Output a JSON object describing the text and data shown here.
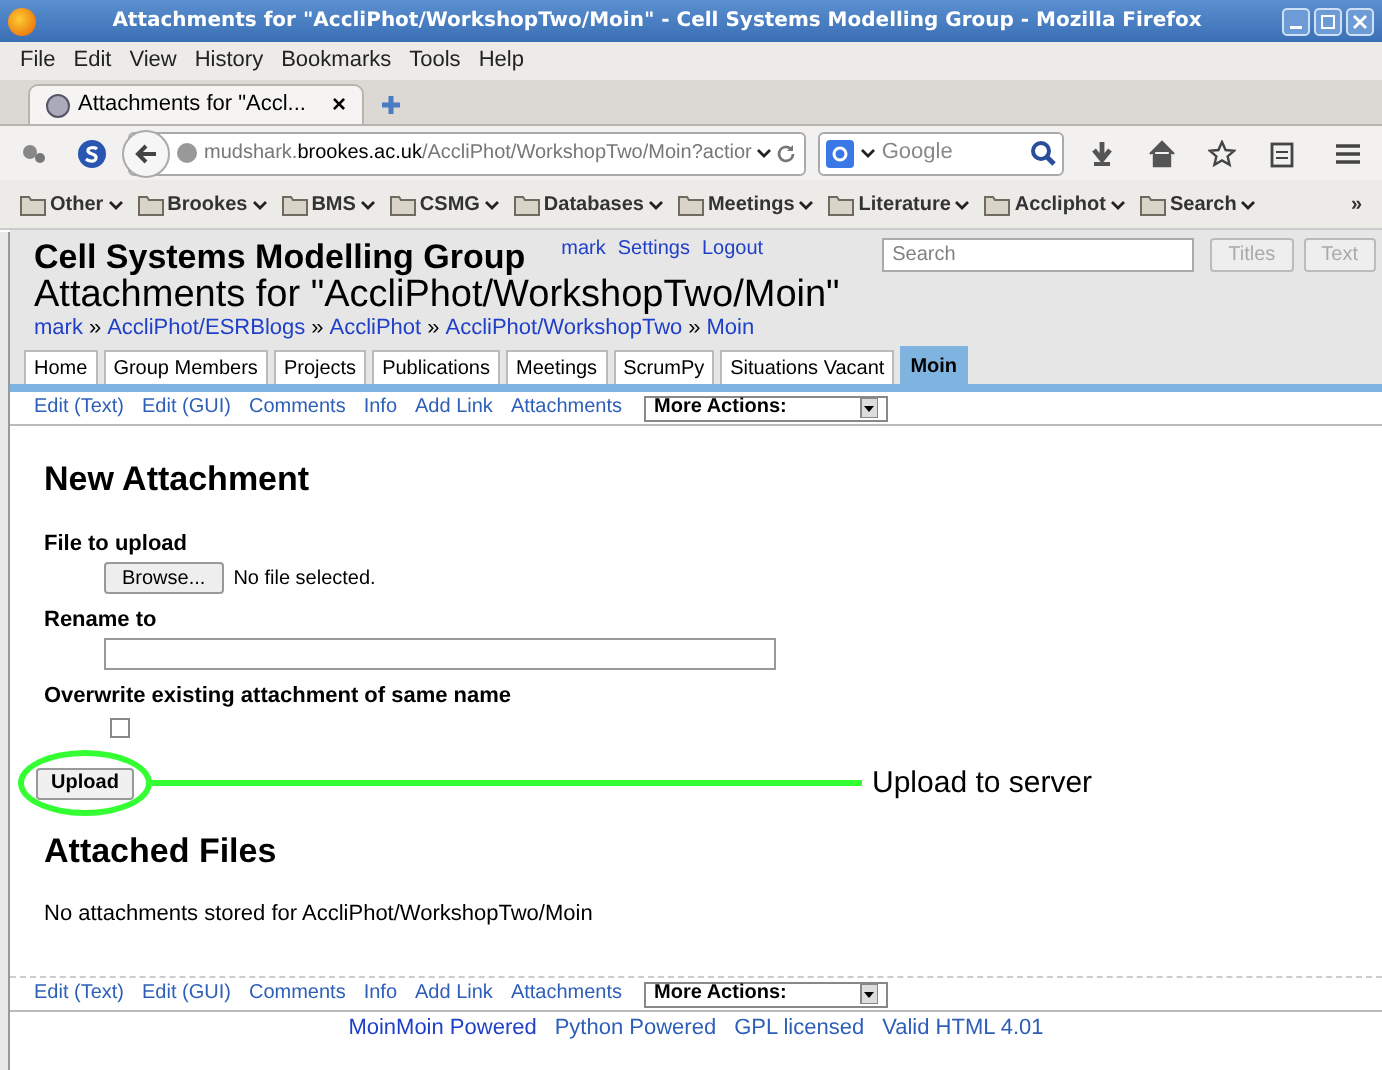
{
  "window": {
    "title": "Attachments for \"AccliPhot/WorkshopTwo/Moin\" - Cell Systems Modelling Group - Mozilla Firefox"
  },
  "menu": [
    "File",
    "Edit",
    "View",
    "History",
    "Bookmarks",
    "Tools",
    "Help"
  ],
  "browser_tab": {
    "title": "Attachments for \"Accl...",
    "close": "×"
  },
  "address": {
    "host_pre": "mudshark.",
    "host": "brookes.ac.uk",
    "path": "/AccliPhot/WorkshopTwo/Moin?actior"
  },
  "search_engine": {
    "placeholder": "Google"
  },
  "bookmarks": [
    "Other",
    "Brookes",
    "BMS",
    "CSMG",
    "Databases",
    "Meetings",
    "Literature",
    "Accliphot",
    "Search"
  ],
  "bookmarks_more": "»",
  "site": {
    "name": "Cell Systems Modelling Group",
    "user_links": [
      "mark",
      "Settings",
      "Logout"
    ],
    "search_placeholder": "Search",
    "search_buttons": [
      "Titles",
      "Text"
    ],
    "page_title": "Attachments for \"AccliPhot/WorkshopTwo/Moin\""
  },
  "breadcrumbs": [
    "mark",
    "AccliPhot/ESRBlogs",
    "AccliPhot",
    "AccliPhot/WorkshopTwo",
    "Moin"
  ],
  "breadcrumb_separators": [
    "»",
    "»",
    "»",
    "»"
  ],
  "nav_tabs": [
    {
      "label": "Home",
      "selected": false
    },
    {
      "label": "Group Members",
      "selected": false
    },
    {
      "label": "Projects",
      "selected": false
    },
    {
      "label": "Publications",
      "selected": false
    },
    {
      "label": "Meetings",
      "selected": false
    },
    {
      "label": "ScrumPy",
      "selected": false
    },
    {
      "label": "Situations Vacant",
      "selected": false
    },
    {
      "label": "Moin",
      "selected": true
    }
  ],
  "actions": [
    "Edit (Text)",
    "Edit (GUI)",
    "Comments",
    "Info",
    "Add Link",
    "Attachments"
  ],
  "more_actions": "More Actions:",
  "form": {
    "heading": "New Attachment",
    "file_label": "File to upload",
    "browse": "Browse...",
    "no_file": "No file selected.",
    "rename_label": "Rename to",
    "overwrite_label": "Overwrite existing attachment of same name",
    "overwrite_checked": false,
    "upload": "Upload"
  },
  "annotation": {
    "text": "Upload to server"
  },
  "attached": {
    "heading": "Attached Files",
    "message": "No attachments stored for AccliPhot/WorkshopTwo/Moin"
  },
  "bottom_actions": [
    "Edit (Text)",
    "Edit (GUI)",
    "Comments",
    "Info",
    "Add Link",
    "Attachments"
  ],
  "bottom_more_actions": "More Actions:",
  "footer_links": [
    "MoinMoin Powered",
    "Python Powered",
    "GPL licensed",
    "Valid HTML 4.01"
  ]
}
